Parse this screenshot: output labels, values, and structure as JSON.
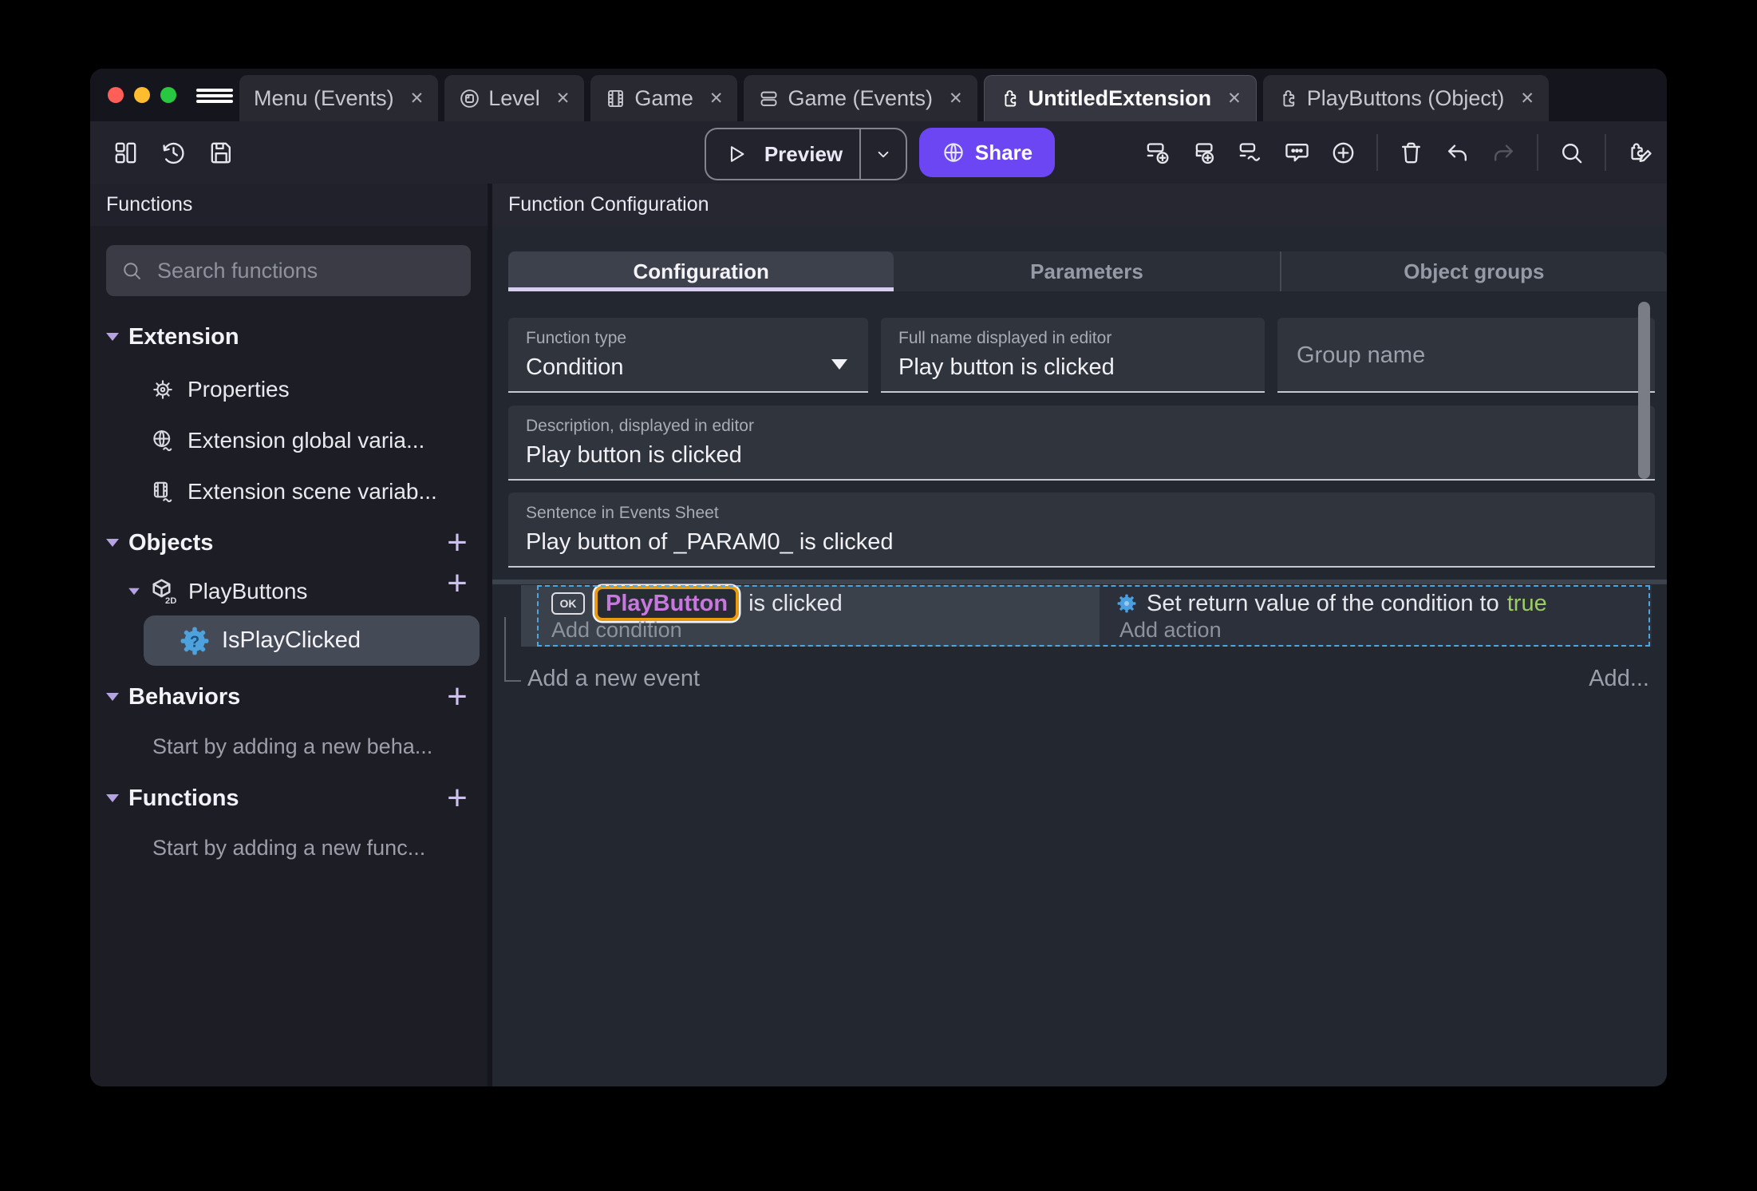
{
  "colors": {
    "share_button": "#6b46f2",
    "tab_underline": "#d7cef2",
    "object_highlight_border": "#e89a10",
    "object_name_text": "#c678dd",
    "true_value_green": "#9ccc65",
    "selection_dashed_border": "#4ba6e4",
    "traffic_red": "#ff5f57",
    "traffic_yellow": "#febc2e",
    "traffic_green": "#28c840"
  },
  "glyphs": {
    "close": "✕",
    "plus": "+"
  },
  "window_tabs": {
    "tabs": [
      {
        "label": "Menu (Events)"
      },
      {
        "label": "Level"
      },
      {
        "label": "Game"
      },
      {
        "label": "Game (Events)"
      },
      {
        "label": "UntitledExtension"
      },
      {
        "label": "PlayButtons (Object)"
      }
    ]
  },
  "toolbar": {
    "preview_label": "Preview",
    "share_label": "Share"
  },
  "sidebar": {
    "title": "Functions",
    "search_placeholder": "Search functions",
    "extension_section": {
      "label": "Extension",
      "items": [
        {
          "label": "Properties"
        },
        {
          "label": "Extension global varia..."
        },
        {
          "label": "Extension scene variab..."
        }
      ]
    },
    "objects_section": {
      "label": "Objects",
      "object_label": "PlayButtons",
      "function_label": "IsPlayClicked"
    },
    "behaviors_section": {
      "label": "Behaviors",
      "hint": "Start by adding a new beha..."
    },
    "functions_section": {
      "label": "Functions",
      "hint": "Start by adding a new func..."
    }
  },
  "main": {
    "header": "Function Configuration",
    "tabs": [
      {
        "label": "Configuration"
      },
      {
        "label": "Parameters"
      },
      {
        "label": "Object groups"
      }
    ],
    "fields": {
      "function_type": {
        "label": "Function type",
        "value": "Condition"
      },
      "full_name": {
        "label": "Full name displayed in editor",
        "value": "Play button is clicked"
      },
      "group_name": {
        "placeholder": "Group name"
      },
      "description": {
        "label": "Description, displayed in editor",
        "value": "Play button is clicked"
      },
      "sentence": {
        "label": "Sentence in Events Sheet",
        "value": "Play button of _PARAM0_ is clicked"
      }
    },
    "events": {
      "condition": {
        "badge": "OK",
        "object": "PlayButton",
        "text": "is clicked",
        "add": "Add condition"
      },
      "action": {
        "prefix": "Set return value of the condition to",
        "value": "true",
        "add": "Add action"
      },
      "add_event": "Add a new event",
      "add_more": "Add..."
    }
  }
}
